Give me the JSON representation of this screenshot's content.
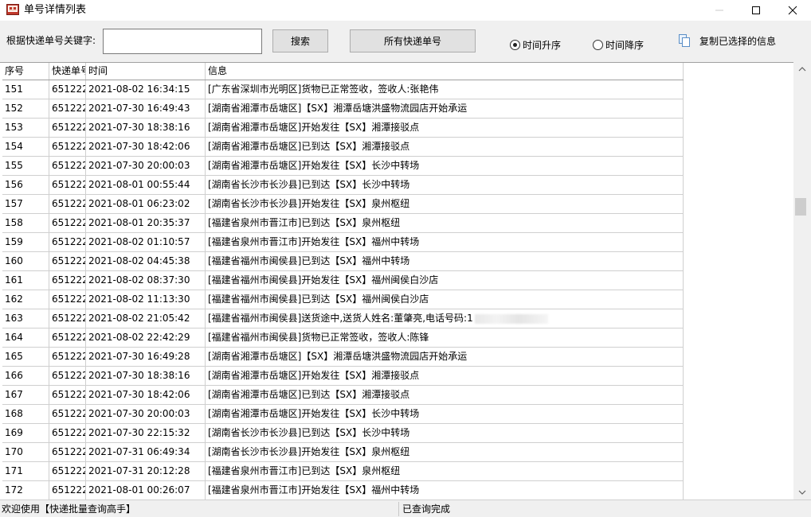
{
  "window": {
    "title": "单号详情列表",
    "controls": {
      "minimize": "minimize-icon",
      "maximize": "maximize-icon",
      "close": "close-icon"
    }
  },
  "toolbar": {
    "keyword_label": "根据快递单号关键字:",
    "keyword_value": "",
    "search_label": "搜索",
    "all_numbers_label": "所有快递单号",
    "sort_asc_label": "时间升序",
    "sort_desc_label": "时间降序",
    "sort_selected": "时间升序",
    "copy_label": "复制已选择的信息"
  },
  "table": {
    "columns": [
      "序号",
      "快递单号",
      "时间",
      "信息"
    ],
    "rows": [
      {
        "no": "151",
        "num": "651222",
        "time": "2021-08-02 16:34:15",
        "info": "[广东省深圳市光明区]货物已正常签收，签收人:张艳伟"
      },
      {
        "no": "152",
        "num": "651222",
        "time": "2021-07-30 16:49:43",
        "info": "[湖南省湘潭市岳塘区]【SX】湘潭岳塘洪盛物流园店开始承运"
      },
      {
        "no": "153",
        "num": "651222",
        "time": "2021-07-30 18:38:16",
        "info": "[湖南省湘潭市岳塘区]开始发往【SX】湘潭接驳点"
      },
      {
        "no": "154",
        "num": "651222",
        "time": "2021-07-30 18:42:06",
        "info": "[湖南省湘潭市岳塘区]已到达【SX】湘潭接驳点"
      },
      {
        "no": "155",
        "num": "651222",
        "time": "2021-07-30 20:00:03",
        "info": "[湖南省湘潭市岳塘区]开始发往【SX】长沙中转场"
      },
      {
        "no": "156",
        "num": "651222",
        "time": "2021-08-01 00:55:44",
        "info": "[湖南省长沙市长沙县]已到达【SX】长沙中转场"
      },
      {
        "no": "157",
        "num": "651222",
        "time": "2021-08-01 06:23:02",
        "info": "[湖南省长沙市长沙县]开始发往【SX】泉州枢纽"
      },
      {
        "no": "158",
        "num": "651222",
        "time": "2021-08-01 20:35:37",
        "info": "[福建省泉州市晋江市]已到达【SX】泉州枢纽"
      },
      {
        "no": "159",
        "num": "651222",
        "time": "2021-08-02 01:10:57",
        "info": "[福建省泉州市晋江市]开始发往【SX】福州中转场"
      },
      {
        "no": "160",
        "num": "651222",
        "time": "2021-08-02 04:45:38",
        "info": "[福建省福州市闽侯县]已到达【SX】福州中转场"
      },
      {
        "no": "161",
        "num": "651222",
        "time": "2021-08-02 08:37:30",
        "info": "[福建省福州市闽侯县]开始发往【SX】福州闽侯白沙店"
      },
      {
        "no": "162",
        "num": "651222",
        "time": "2021-08-02 11:13:30",
        "info": "[福建省福州市闽侯县]已到达【SX】福州闽侯白沙店"
      },
      {
        "no": "163",
        "num": "651222",
        "time": "2021-08-02 21:05:42",
        "info": "[福建省福州市闽侯县]送货途中,送货人姓名:董肇亮,电话号码:1",
        "redacted": true
      },
      {
        "no": "164",
        "num": "651222",
        "time": "2021-08-02 22:42:29",
        "info": "[福建省福州市闽侯县]货物已正常签收，签收人:陈锋"
      },
      {
        "no": "165",
        "num": "651222",
        "time": "2021-07-30 16:49:28",
        "info": "[湖南省湘潭市岳塘区]【SX】湘潭岳塘洪盛物流园店开始承运"
      },
      {
        "no": "166",
        "num": "651222",
        "time": "2021-07-30 18:38:16",
        "info": "[湖南省湘潭市岳塘区]开始发往【SX】湘潭接驳点"
      },
      {
        "no": "167",
        "num": "651222",
        "time": "2021-07-30 18:42:06",
        "info": "[湖南省湘潭市岳塘区]已到达【SX】湘潭接驳点"
      },
      {
        "no": "168",
        "num": "651222",
        "time": "2021-07-30 20:00:03",
        "info": "[湖南省湘潭市岳塘区]开始发往【SX】长沙中转场"
      },
      {
        "no": "169",
        "num": "651222",
        "time": "2021-07-30 22:15:32",
        "info": "[湖南省长沙市长沙县]已到达【SX】长沙中转场"
      },
      {
        "no": "170",
        "num": "651222",
        "time": "2021-07-31 06:49:34",
        "info": "[湖南省长沙市长沙县]开始发往【SX】泉州枢纽"
      },
      {
        "no": "171",
        "num": "651222",
        "time": "2021-07-31 20:12:28",
        "info": "[福建省泉州市晋江市]已到达【SX】泉州枢纽"
      },
      {
        "no": "172",
        "num": "651222",
        "time": "2021-08-01 00:26:07",
        "info": "[福建省泉州市晋江市]开始发往【SX】福州中转场"
      }
    ]
  },
  "status": {
    "left": "欢迎使用【快递批量查询高手】",
    "right": "已查询完成"
  }
}
